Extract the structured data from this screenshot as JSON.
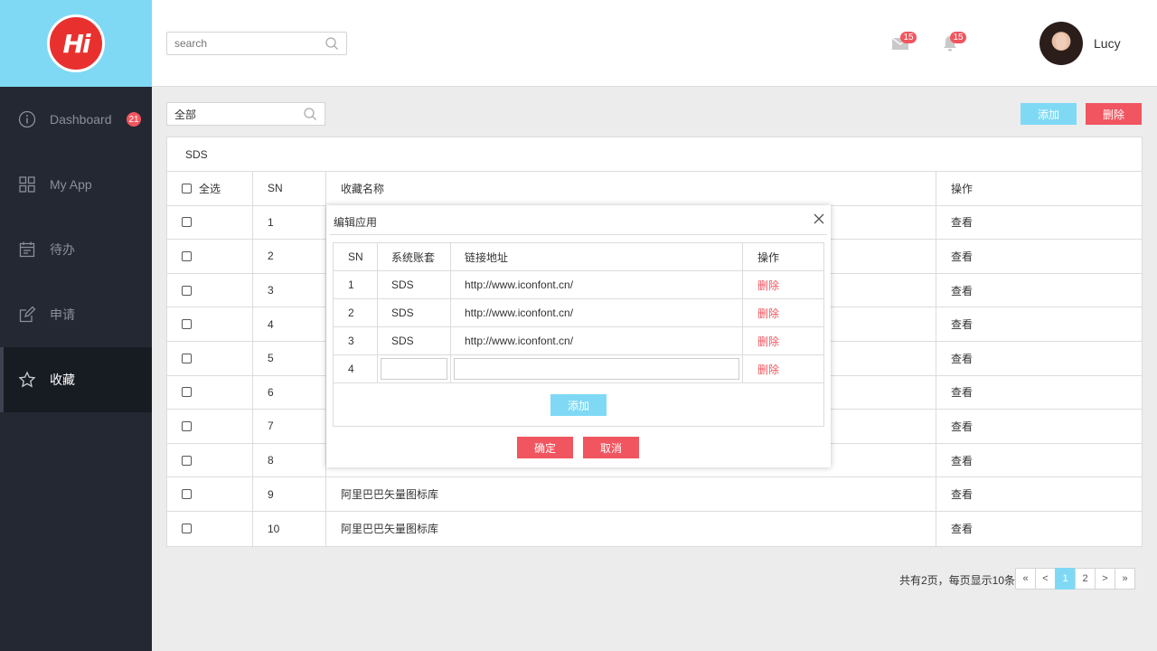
{
  "logo": {
    "text": "Hi"
  },
  "sidebar": {
    "items": [
      {
        "label": "Dashboard",
        "icon": "info-circle-icon",
        "badge": "21"
      },
      {
        "label": "My App",
        "icon": "grid-icon"
      },
      {
        "label": "待办",
        "icon": "calendar-icon"
      },
      {
        "label": "申请",
        "icon": "edit-icon"
      },
      {
        "label": "收藏",
        "icon": "star-icon",
        "active": true
      }
    ]
  },
  "header": {
    "search_placeholder": "search",
    "mail_count": "15",
    "bell_count": "15",
    "username": "Lucy"
  },
  "toolbar": {
    "filter_value": "全部",
    "add_label": "添加",
    "delete_label": "删除"
  },
  "table": {
    "title": "SDS",
    "headers": {
      "select_all": "全选",
      "sn": "SN",
      "name": "收藏名称",
      "action": "操作"
    },
    "rows": [
      {
        "sn": "1",
        "name": "",
        "action": "查看"
      },
      {
        "sn": "2",
        "name": "",
        "action": "查看"
      },
      {
        "sn": "3",
        "name": "",
        "action": "查看"
      },
      {
        "sn": "4",
        "name": "",
        "action": "查看"
      },
      {
        "sn": "5",
        "name": "",
        "action": "查看"
      },
      {
        "sn": "6",
        "name": "",
        "action": "查看"
      },
      {
        "sn": "7",
        "name": "",
        "action": "查看"
      },
      {
        "sn": "8",
        "name": "",
        "action": "查看"
      },
      {
        "sn": "9",
        "name": "阿里巴巴矢量图标库",
        "action": "查看"
      },
      {
        "sn": "10",
        "name": "阿里巴巴矢量图标库",
        "action": "查看"
      }
    ]
  },
  "pagination": {
    "summary": "共有2页，每页显示10条",
    "first": "«",
    "prev": "<",
    "pages": [
      "1",
      "2"
    ],
    "current": "1",
    "next": ">",
    "last": "»"
  },
  "modal": {
    "title": "编辑应用",
    "headers": {
      "sn": "SN",
      "account": "系统账套",
      "url": "链接地址",
      "action": "操作"
    },
    "rows": [
      {
        "sn": "1",
        "account": "SDS",
        "url": "http://www.iconfont.cn/",
        "action": "删除"
      },
      {
        "sn": "2",
        "account": "SDS",
        "url": "http://www.iconfont.cn/",
        "action": "删除"
      },
      {
        "sn": "3",
        "account": "SDS",
        "url": "http://www.iconfont.cn/",
        "action": "删除"
      }
    ],
    "new_row": {
      "sn": "4",
      "account": "",
      "url": "",
      "action": "删除"
    },
    "add_label": "添加",
    "confirm_label": "确定",
    "cancel_label": "取消"
  },
  "colors": {
    "accent": "#7fd9f5",
    "danger": "#f1555f",
    "sidebar": "#232832"
  }
}
